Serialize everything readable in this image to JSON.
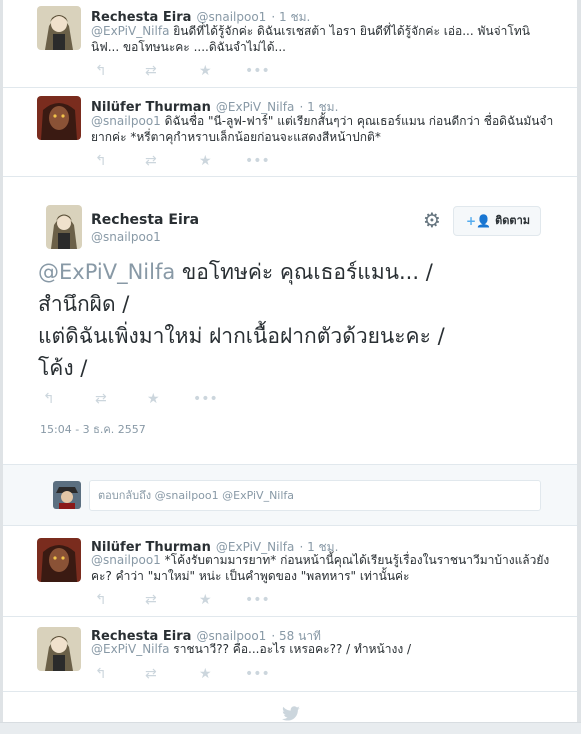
{
  "tweets": [
    {
      "name": "Rechesta Eira",
      "handle": "@snailpoo1",
      "time": "· 1 ชม.",
      "reply_to": "@ExPiV_Nilfa",
      "text_line1": "ยินดีที่ได้รู้จักค่ะ ดิฉันเรเชสต้า ไอรา ยินดีที่ได้รู้จักค่ะ เอ่อ... พันจ่าโทนิ",
      "text_line2": "นิฟ... ขอโทษนะคะ ....ดิฉันจำไม่ได้..."
    },
    {
      "name": "Nilüfer Thurman",
      "handle": "@ExPiV_Nilfa",
      "time": "· 1 ชม.",
      "reply_to": "@snailpoo1",
      "text_line1": "ดิฉันชื่อ \"นี-ลูฟ-ฟาร์\" แต่เรียกสั้นๆว่า คุณเธอร์แมน ก่อนดีกว่า ชื่อดิฉันมันจำ",
      "text_line2": "ยากค่ะ *หรี่ตาคุกำหราบเล็กน้อยก่อนจะแสดงสีหน้าปกติ*"
    }
  ],
  "focused": {
    "name": "Rechesta Eira",
    "handle": "@snailpoo1",
    "follow_label": "ติดตาม",
    "reply_to": "@ExPiV_Nilfa",
    "line1": " ขอโทษค่ะ คุณเธอร์แมน... /",
    "line2": "สำนึกผิด /",
    "line3": "แต่ดิฉันเพิ่งมาใหม่ ฝากเนื้อฝากตัวด้วยนะคะ /",
    "line4": "โค้ง /",
    "timestamp": "15:04 - 3 ธ.ค. 2557"
  },
  "reply_box": {
    "placeholder": "ตอบกลับถึง @snailpoo1 @ExPiV_Nilfa"
  },
  "replies": [
    {
      "name": "Nilüfer Thurman",
      "handle": "@ExPiV_Nilfa",
      "time": "· 1 ชม.",
      "reply_to": "@snailpoo1",
      "text_line1": "*โค้งรับตามมารยาท* ก่อนหน้านี้คุณได้เรียนรู้เรื่องในราชนาวีมาบ้างแล้วยัง",
      "text_line2": "คะ? คำว่า \"มาใหม่\" หน่ะ เป็นคำพูดของ \"พลทหาร\" เท่านั้นค่ะ"
    },
    {
      "name": "Rechesta Eira",
      "handle": "@snailpoo1",
      "time": "· 58 นาที",
      "reply_to": "@ExPiV_Nilfa",
      "text_line1": "ราชนาวี?? คือ...อะไร เหรอคะ?? / ทำหน้างง /",
      "text_line2": ""
    }
  ],
  "icons": [
    "reply-icon",
    "retweet-icon",
    "favorite-icon",
    "more-icon",
    "gear-icon",
    "follow-user-icon",
    "twitter-bird-icon"
  ],
  "colors": {
    "muted": "#8899a6",
    "text": "#292f33",
    "border": "#e1e8ed",
    "bird": "#ccd6dd"
  }
}
